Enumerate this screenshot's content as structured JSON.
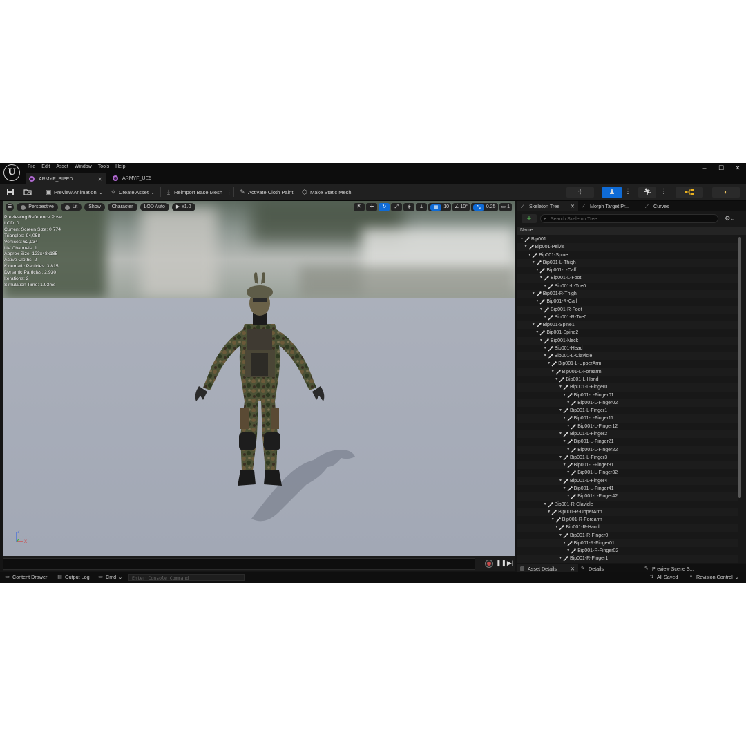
{
  "menu": [
    "File",
    "Edit",
    "Asset",
    "Window",
    "Tools",
    "Help"
  ],
  "document_tabs": [
    {
      "label": "ARMYF_BIPED",
      "active": true
    },
    {
      "label": "ARMYF_UE5",
      "active": false
    }
  ],
  "window_controls": {
    "minimize": "–",
    "maximize": "☐",
    "close": "✕"
  },
  "toolbar": {
    "preview_animation": "Preview Animation",
    "create_asset": "Create Asset",
    "reimport_base_mesh": "Reimport Base Mesh",
    "activate_cloth_paint": "Activate Cloth Paint",
    "make_static_mesh": "Make Static Mesh"
  },
  "viewport": {
    "perspective": "Perspective",
    "lit": "Lit",
    "show": "Show",
    "character": "Character",
    "lod": "LOD Auto",
    "play_rate": "x1.0",
    "grid_size": "10",
    "rotation_snap": "10°",
    "scale_snap": "0.25",
    "camera_speed": "1",
    "stats": [
      "Previewing Reference Pose",
      "LOD: 0",
      "Current Screen Size: 0.774",
      "Triangles: 94,058",
      "Vertices: 62,934",
      "UV Channels: 1",
      "Approx Size: 123x48x185",
      "Active Cloths: 2",
      "Kinematic Particles: 3,815",
      "Dynamic Particles: 2,930",
      "Iterations: 2",
      "Simulation Time: 1.93ms"
    ],
    "axis": {
      "z": "Z",
      "x": "X"
    }
  },
  "right_panel": {
    "tabs": [
      "Skeleton Tree",
      "Morph Target Pr...",
      "Curves"
    ],
    "search_placeholder": "Search Skeleton Tree...",
    "column_name": "Name",
    "tree": [
      {
        "label": "Bip001",
        "depth": 0
      },
      {
        "label": "Bip001-Pelvis",
        "depth": 1
      },
      {
        "label": "Bip001-Spine",
        "depth": 2
      },
      {
        "label": "Bip001-L-Thigh",
        "depth": 3
      },
      {
        "label": "Bip001-L-Calf",
        "depth": 4
      },
      {
        "label": "Bip001-L-Foot",
        "depth": 5
      },
      {
        "label": "Bip001-L-Toe0",
        "depth": 6
      },
      {
        "label": "Bip001-R-Thigh",
        "depth": 3
      },
      {
        "label": "Bip001-R-Calf",
        "depth": 4
      },
      {
        "label": "Bip001-R-Foot",
        "depth": 5
      },
      {
        "label": "Bip001-R-Toe0",
        "depth": 6
      },
      {
        "label": "Bip001-Spine1",
        "depth": 3
      },
      {
        "label": "Bip001-Spine2",
        "depth": 4
      },
      {
        "label": "Bip001-Neck",
        "depth": 5
      },
      {
        "label": "Bip001-Head",
        "depth": 6
      },
      {
        "label": "Bip001-L-Clavicle",
        "depth": 6
      },
      {
        "label": "Bip001-L-UpperArm",
        "depth": 7
      },
      {
        "label": "Bip001-L-Forearm",
        "depth": 8
      },
      {
        "label": "Bip001-L-Hand",
        "depth": 9
      },
      {
        "label": "Bip001-L-Finger0",
        "depth": 10
      },
      {
        "label": "Bip001-L-Finger01",
        "depth": 11
      },
      {
        "label": "Bip001-L-Finger02",
        "depth": 12
      },
      {
        "label": "Bip001-L-Finger1",
        "depth": 10
      },
      {
        "label": "Bip001-L-Finger11",
        "depth": 11
      },
      {
        "label": "Bip001-L-Finger12",
        "depth": 12
      },
      {
        "label": "Bip001-L-Finger2",
        "depth": 10
      },
      {
        "label": "Bip001-L-Finger21",
        "depth": 11
      },
      {
        "label": "Bip001-L-Finger22",
        "depth": 12
      },
      {
        "label": "Bip001-L-Finger3",
        "depth": 10
      },
      {
        "label": "Bip001-L-Finger31",
        "depth": 11
      },
      {
        "label": "Bip001-L-Finger32",
        "depth": 12
      },
      {
        "label": "Bip001-L-Finger4",
        "depth": 10
      },
      {
        "label": "Bip001-L-Finger41",
        "depth": 11
      },
      {
        "label": "Bip001-L-Finger42",
        "depth": 12
      },
      {
        "label": "Bip001-R-Clavicle",
        "depth": 6
      },
      {
        "label": "Bip001-R-UpperArm",
        "depth": 7
      },
      {
        "label": "Bip001-R-Forearm",
        "depth": 8
      },
      {
        "label": "Bip001-R-Hand",
        "depth": 9
      },
      {
        "label": "Bip001-R-Finger0",
        "depth": 10
      },
      {
        "label": "Bip001-R-Finger01",
        "depth": 11
      },
      {
        "label": "Bip001-R-Finger02",
        "depth": 12
      },
      {
        "label": "Bip001-R-Finger1",
        "depth": 10
      }
    ]
  },
  "bottom_tabs": [
    "Asset Details",
    "Details",
    "Preview Scene S..."
  ],
  "statusbar": {
    "content_drawer": "Content Drawer",
    "output_log": "Output Log",
    "cmd": "Cmd",
    "console_placeholder": "Enter Console Command",
    "all_saved": "All Saved",
    "revision_control": "Revision Control"
  },
  "colors": {
    "accent": "#0f6bd6",
    "add_green": "#5ac25a",
    "asset_icon": "#b06ad0"
  }
}
